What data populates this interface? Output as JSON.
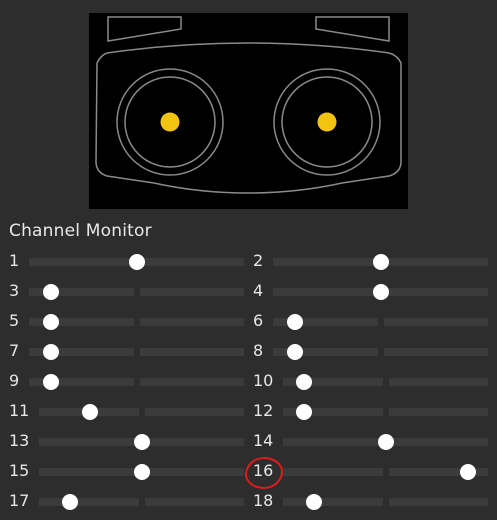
{
  "section_title": "Channel Monitor",
  "accent_color": "#f2c40f",
  "highlight_color": "#e11b1b",
  "channels": [
    {
      "label": "1",
      "level": 0.5
    },
    {
      "label": "2",
      "level": 0.5
    },
    {
      "label": "3",
      "level": 0.1
    },
    {
      "label": "4",
      "level": 0.5
    },
    {
      "label": "5",
      "level": 0.1
    },
    {
      "label": "6",
      "level": 0.1
    },
    {
      "label": "7",
      "level": 0.1
    },
    {
      "label": "8",
      "level": 0.1
    },
    {
      "label": "9",
      "level": 0.1
    },
    {
      "label": "10",
      "level": 0.1
    },
    {
      "label": "11",
      "level": 0.25
    },
    {
      "label": "12",
      "level": 0.1
    },
    {
      "label": "13",
      "level": 0.5
    },
    {
      "label": "14",
      "level": 0.5
    },
    {
      "label": "15",
      "level": 0.5
    },
    {
      "label": "16",
      "level": 0.9
    },
    {
      "label": "17",
      "level": 0.15
    },
    {
      "label": "18",
      "level": 0.15
    }
  ]
}
